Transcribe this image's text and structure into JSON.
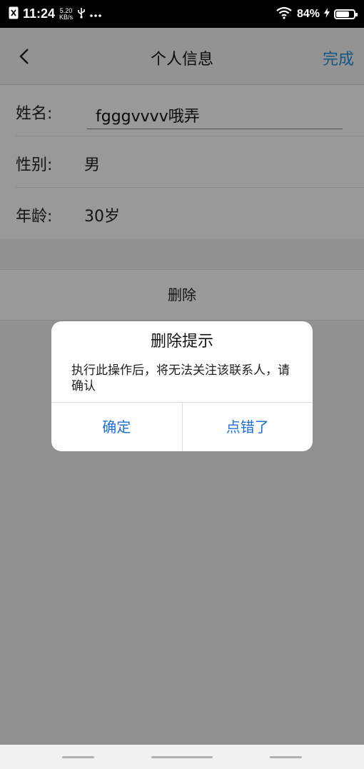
{
  "status_bar": {
    "time": "11:24",
    "net_speed_value": "5.20",
    "net_speed_unit": "KB/s",
    "battery_percent": "84%",
    "battery_level": 0.84
  },
  "header": {
    "title": "个人信息",
    "done_label": "完成"
  },
  "form": {
    "name_label": "姓名:",
    "name_value": "fgggvvvv哦弄",
    "gender_label": "性别:",
    "gender_value": "男",
    "age_label": "年龄:",
    "age_value": "30岁"
  },
  "delete_label": "删除",
  "dialog": {
    "title": "删除提示",
    "message": "执行此操作后，将无法关注该联系人，请确认",
    "confirm_label": "确定",
    "cancel_label": "点错了"
  },
  "colors": {
    "accent": "#2a8fd8",
    "dialog_button": "#1e6fd9"
  }
}
